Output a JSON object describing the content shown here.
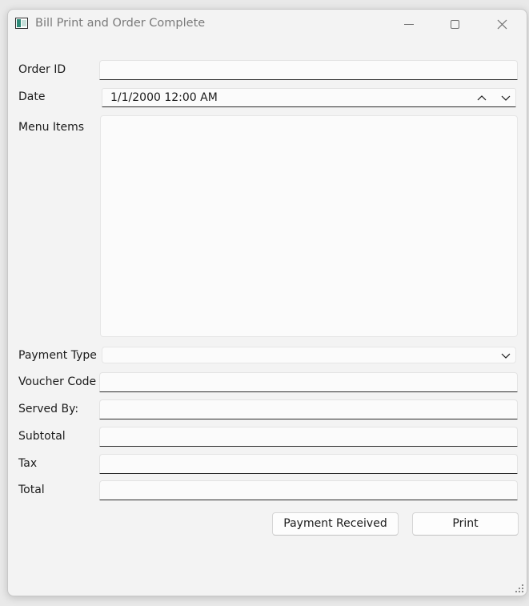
{
  "window": {
    "title": "Bill Print and Order Complete",
    "icon": "app-window-icon",
    "controls": [
      "minimize-icon",
      "maximize-icon",
      "close-icon"
    ]
  },
  "form": {
    "order_id": {
      "label": "Order ID",
      "value": ""
    },
    "date": {
      "label": "Date",
      "value": "1/1/2000 12:00 AM"
    },
    "menu_items": {
      "label": "Menu Items",
      "items": []
    },
    "payment_type": {
      "label": "Payment Type",
      "value": ""
    },
    "voucher_code": {
      "label": "Voucher Code",
      "value": ""
    },
    "served_by": {
      "label": "Served By:",
      "value": ""
    },
    "subtotal": {
      "label": "Subtotal",
      "value": ""
    },
    "tax": {
      "label": "Tax",
      "value": ""
    },
    "total": {
      "label": "Total",
      "value": ""
    }
  },
  "buttons": {
    "payment_received": "Payment Received",
    "print": "Print"
  },
  "colors": {
    "window_bg": "#f3f3f3",
    "field_bg": "#fbfbfb",
    "field_underline": "#2a2a2a",
    "title_text": "#7a7a7a"
  }
}
